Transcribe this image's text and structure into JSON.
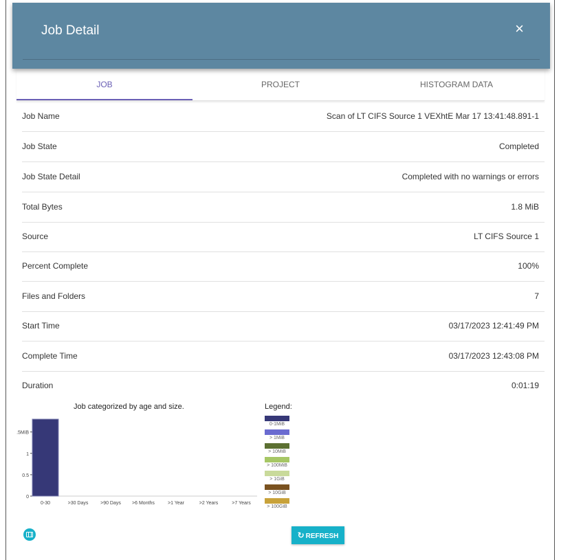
{
  "dialog": {
    "title": "Job Detail",
    "close_label": "×"
  },
  "tabs": [
    {
      "label": "JOB",
      "active": true
    },
    {
      "label": "PROJECT",
      "active": false
    },
    {
      "label": "HISTOGRAM DATA",
      "active": false
    }
  ],
  "details": [
    {
      "label": "Job Name",
      "value": "Scan of LT CIFS Source 1 VEXhtE Mar 17 13:41:48.891-1"
    },
    {
      "label": "Job State",
      "value": "Completed"
    },
    {
      "label": "Job State Detail",
      "value": "Completed with no warnings or errors"
    },
    {
      "label": "Total Bytes",
      "value": "1.8 MiB"
    },
    {
      "label": "Source",
      "value": "LT CIFS Source 1"
    },
    {
      "label": "Percent Complete",
      "value": "100%"
    },
    {
      "label": "Files and Folders",
      "value": "7"
    },
    {
      "label": "Start Time",
      "value": "03/17/2023 12:41:49 PM"
    },
    {
      "label": "Complete Time",
      "value": "03/17/2023 12:43:08 PM"
    },
    {
      "label": "Duration",
      "value": "0:01:19"
    }
  ],
  "chart_data": {
    "type": "bar",
    "title": "Job categorized by age and size.",
    "categories": [
      "0-30",
      ">30 Days",
      ">90 Days",
      ">6 Months",
      ">1 Year",
      ">2 Years",
      ">7 Years"
    ],
    "series": [
      {
        "name": "0-1MiB",
        "values": [
          1.8,
          0,
          0,
          0,
          0,
          0,
          0
        ]
      }
    ],
    "yticks": [
      {
        "value": 0,
        "label": "0"
      },
      {
        "value": 0.5,
        "label": "0.5"
      },
      {
        "value": 1,
        "label": "1"
      },
      {
        "value": 1.5,
        "label": "1.5MiB"
      }
    ],
    "ylim": [
      0,
      1.8
    ],
    "legend": {
      "title": "Legend:",
      "items": [
        {
          "label": "0-1MiB",
          "color": "#363877"
        },
        {
          "label": "> 1MiB",
          "color": "#6a6bd0"
        },
        {
          "label": "> 10MiB",
          "color": "#5c7032"
        },
        {
          "label": "> 100MiB",
          "color": "#a6c765"
        },
        {
          "label": "> 1GiB",
          "color": "#c9da9b"
        },
        {
          "label": "> 10GiB",
          "color": "#7a5220"
        },
        {
          "label": "> 100GiB",
          "color": "#c8a23a"
        }
      ]
    }
  },
  "footer": {
    "refresh_label": "REFRESH"
  }
}
